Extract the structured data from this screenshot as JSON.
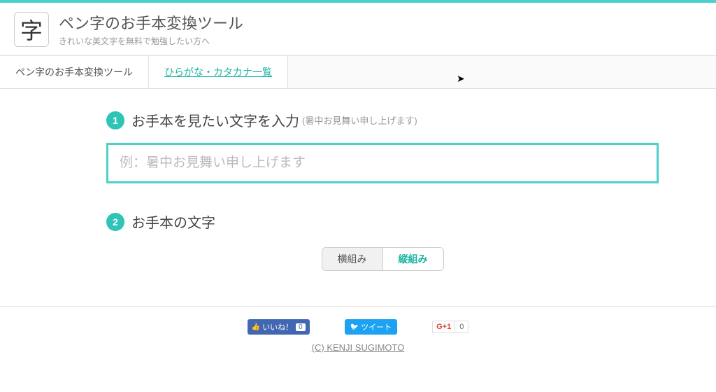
{
  "header": {
    "logo_char": "字",
    "title": "ペン字のお手本変換ツール",
    "subtitle": "きれいな美文字を無料で勉強したい方へ"
  },
  "nav": {
    "items": [
      {
        "label": "ペン字のお手本変換ツール"
      },
      {
        "label": "ひらがな・カタカナ一覧"
      }
    ]
  },
  "section1": {
    "badge": "1",
    "title": "お手本を見たい文字を入力",
    "hint": "(暑中お見舞い申し上げます)",
    "placeholder": "例：暑中お見舞い申し上げます"
  },
  "section2": {
    "badge": "2",
    "title": "お手本の文字"
  },
  "toggle": {
    "horizontal": "横組み",
    "vertical": "縦組み"
  },
  "social": {
    "fb_label": "いいね！",
    "fb_count": "0",
    "tw_label": "ツイート",
    "gp_label": "G+1",
    "gp_count": "0"
  },
  "footer": {
    "copyright": "(C) KENJI SUGIMOTO"
  }
}
